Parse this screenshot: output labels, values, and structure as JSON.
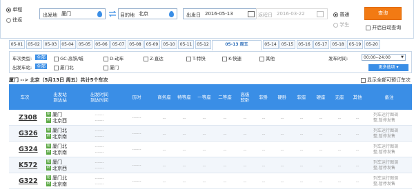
{
  "search": {
    "trip_types": [
      {
        "label": "单程",
        "selected": true
      },
      {
        "label": "往返",
        "selected": false
      }
    ],
    "from_label": "出发地",
    "from_value": "厦门",
    "to_label": "目的地",
    "to_value": "北京",
    "date_label": "出发日",
    "date_value": "2016-05-13",
    "return_label": "返程日",
    "return_value": "2016-03-22",
    "passenger_types": [
      {
        "label": "普通",
        "selected": true
      },
      {
        "label": "学生",
        "selected": false
      }
    ],
    "query_button": "查询",
    "auto_query_label": "开启自动查询"
  },
  "date_tabs": [
    {
      "label": "05-01"
    },
    {
      "label": "05-02"
    },
    {
      "label": "05-03"
    },
    {
      "label": "05-04"
    },
    {
      "label": "05-05"
    },
    {
      "label": "05-06"
    },
    {
      "label": "05-07"
    },
    {
      "label": "05-08"
    },
    {
      "label": "05-09"
    },
    {
      "label": "05-10"
    },
    {
      "label": "05-11"
    },
    {
      "label": "05-12"
    },
    {
      "label": "05-13 周五",
      "active": true
    },
    {
      "label": "05-14"
    },
    {
      "label": "05-15"
    },
    {
      "label": "05-16"
    },
    {
      "label": "05-17"
    },
    {
      "label": "05-18"
    },
    {
      "label": "05-19"
    },
    {
      "label": "05-20"
    }
  ],
  "filter": {
    "type_label": "车次类型:",
    "station_label": "出发车站:",
    "all_tag": "全部",
    "train_types": [
      "GC-高铁/城",
      "D-动车",
      "Z-直达",
      "T-特快",
      "K-快速",
      "其他"
    ],
    "stations": [
      "厦门北",
      "厦门"
    ],
    "time_label": "发车时间:",
    "time_value": "00:00--24:00",
    "more_options": "更多选项"
  },
  "summary": {
    "text": "厦门 --> 北京（5月13日 周五）共计5个车次",
    "show_all_label": "显示全部可预订车次"
  },
  "table": {
    "headers": {
      "train": "车次",
      "station": "出发站\n到达站",
      "time": "出发时间\n到达时间",
      "duration": "历时",
      "business": "商务座",
      "special": "特等座",
      "first": "一等座",
      "second": "二等座",
      "adv_soft": "高级\n软卧",
      "soft_sleeper": "软卧",
      "hard_sleeper": "硬卧",
      "soft_seat": "软座",
      "hard_seat": "硬座",
      "no_seat": "无座",
      "other": "其他",
      "note": "备注"
    },
    "rows": [
      {
        "code": "Z308",
        "from": "厦门",
        "from_badge": "始",
        "to": "北京西",
        "to_badge": "终",
        "dep": "------",
        "arr": "------",
        "dur": "------",
        "seats": "--",
        "note": "列车运行图调\n整,暂停发售"
      },
      {
        "code": "G326",
        "from": "厦门北",
        "from_badge": "始",
        "to": "北京南",
        "to_badge": "终",
        "dep": "------",
        "arr": "------",
        "dur": "------",
        "seats": "--",
        "note": "列车运行图调\n整,暂停发售"
      },
      {
        "code": "G324",
        "from": "厦门北",
        "from_badge": "始",
        "to": "北京南",
        "to_badge": "终",
        "dep": "------",
        "arr": "------",
        "dur": "------",
        "seats": "--",
        "note": "列车运行图调\n整,暂停发售"
      },
      {
        "code": "K572",
        "from": "厦门",
        "from_badge": "始",
        "to": "北京西",
        "to_badge": "终",
        "dep": "------",
        "arr": "------",
        "dur": "------",
        "seats": "--",
        "note": "列车运行图调\n整,暂停发售"
      },
      {
        "code": "G322",
        "from": "厦门北",
        "from_badge": "始",
        "to": "北京南",
        "to_badge": "终",
        "dep": "------",
        "arr": "------",
        "dur": "------",
        "seats": "--",
        "note": "列车运行图调\n整,暂停发售"
      }
    ]
  },
  "colors": {
    "accent": "#3a8ee6",
    "button": "#f27a13"
  }
}
